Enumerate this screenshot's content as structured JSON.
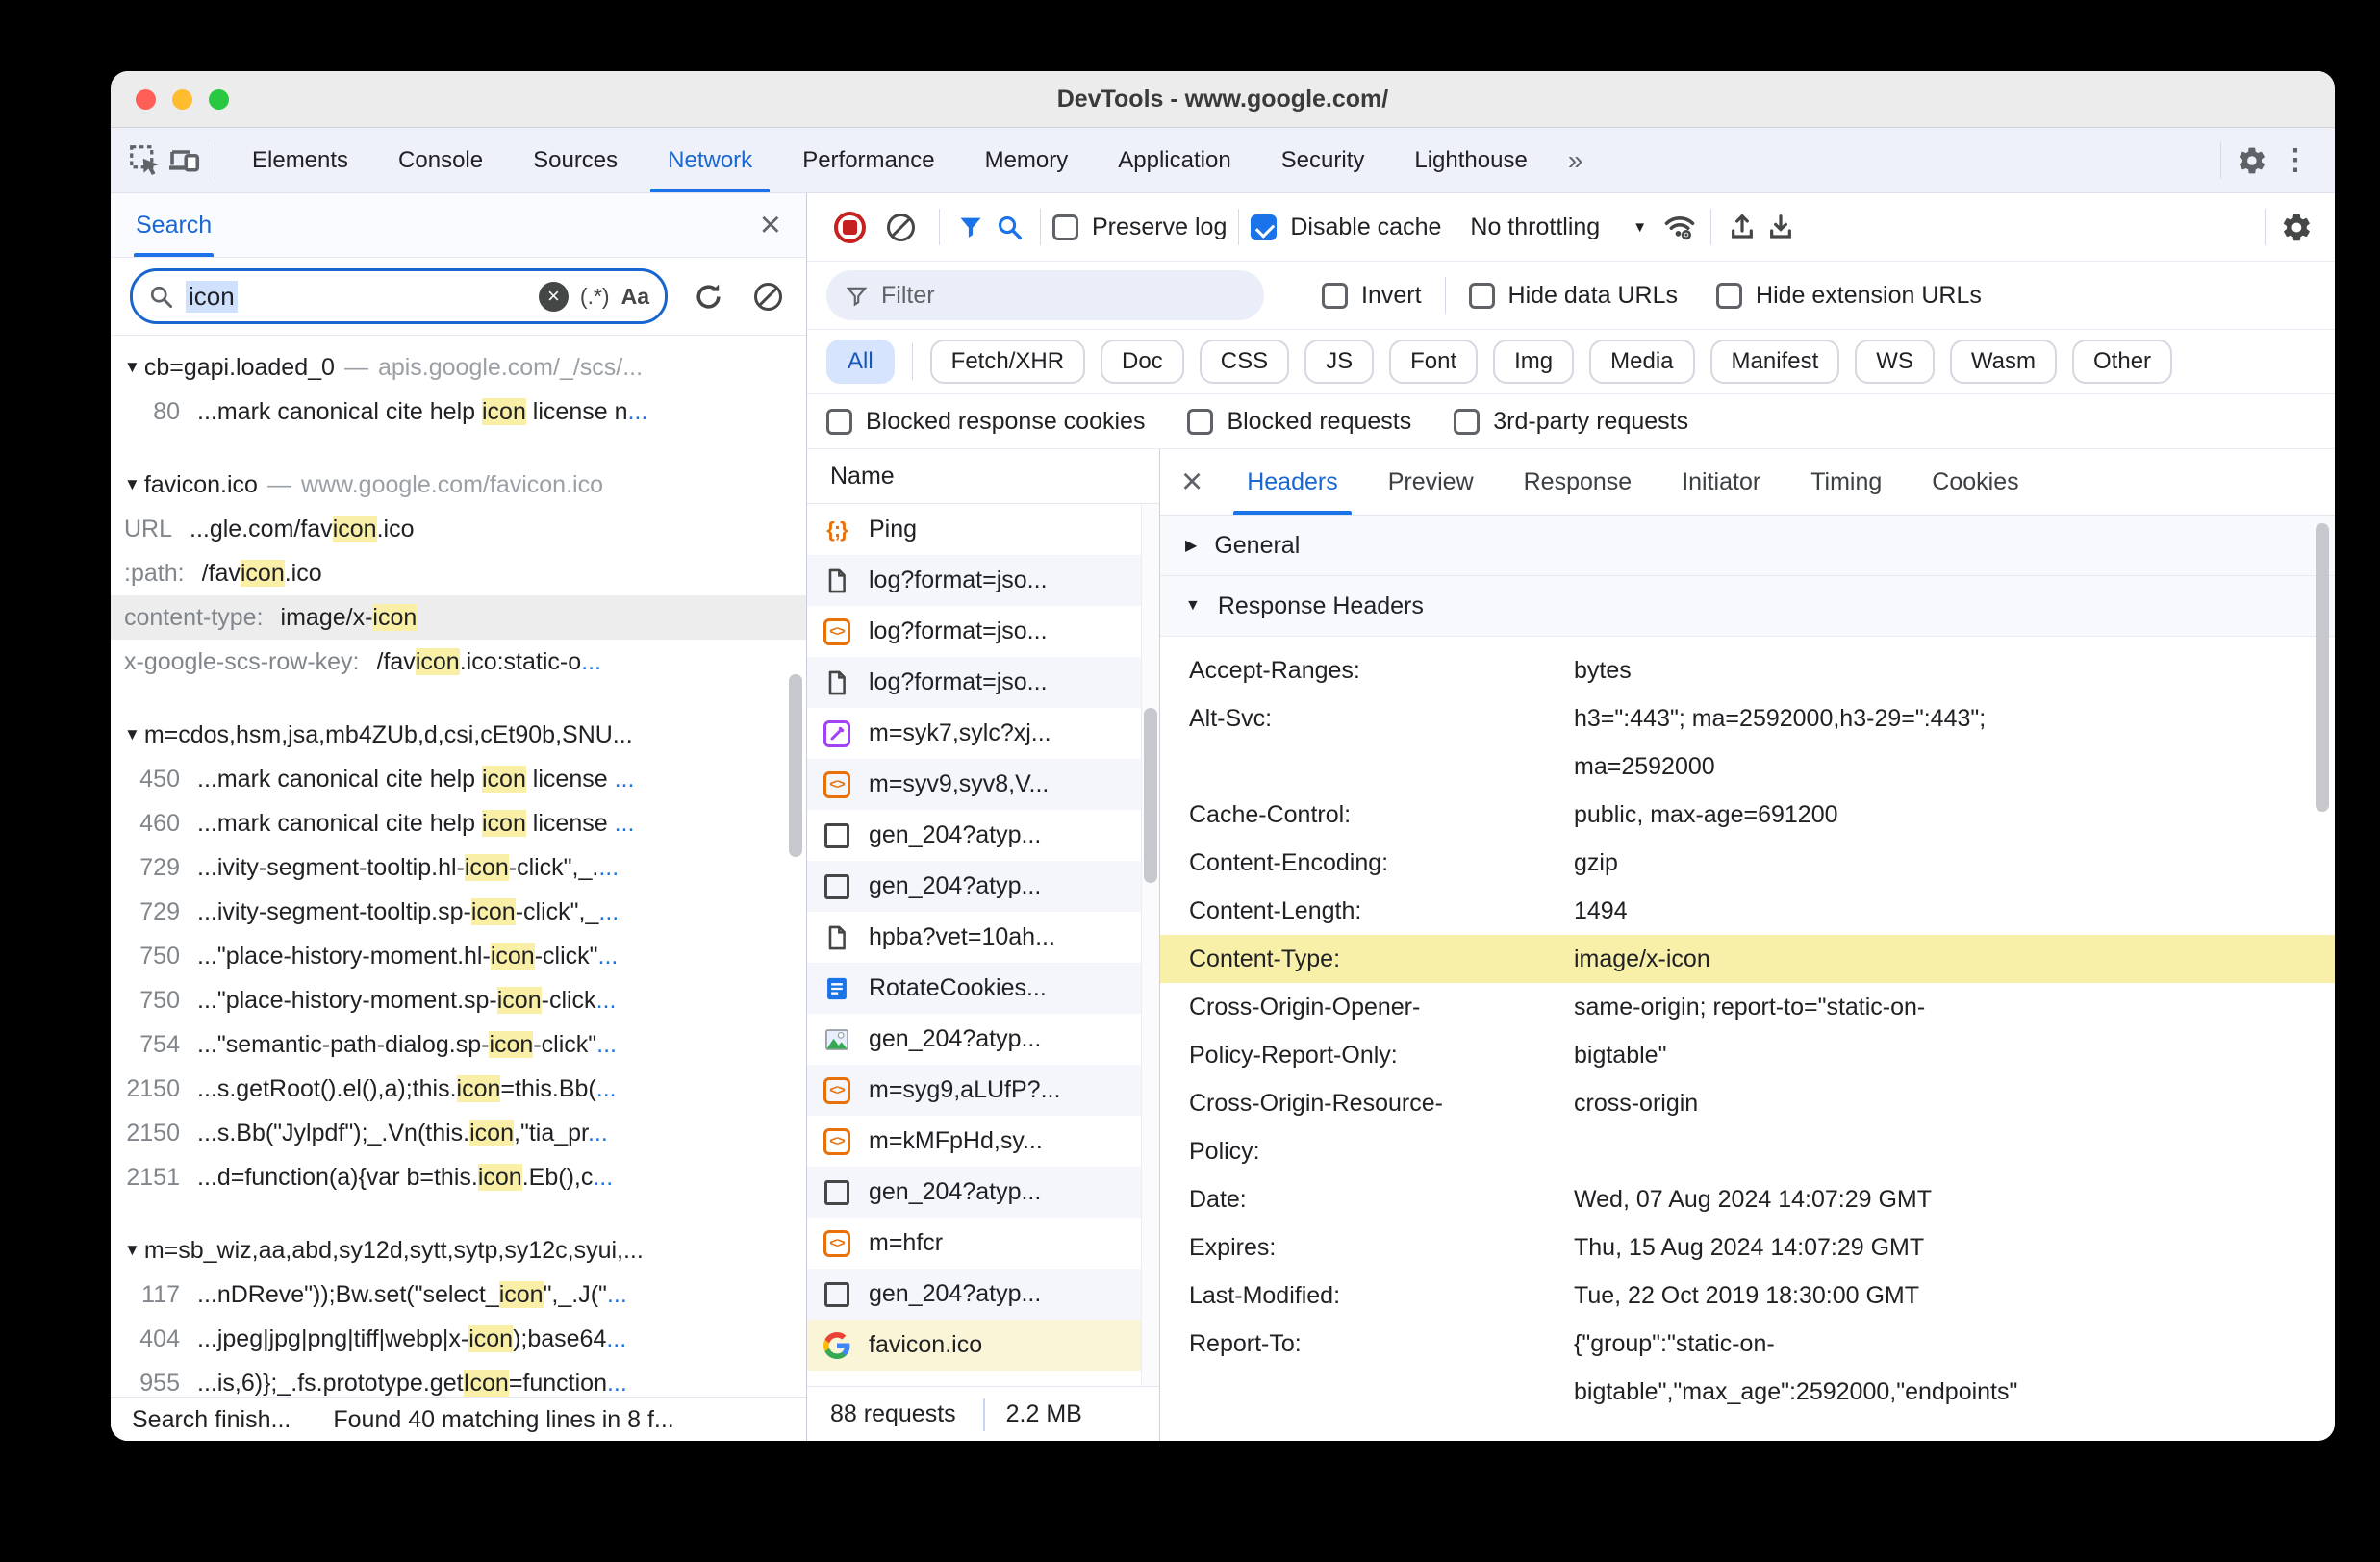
{
  "window": {
    "title": "DevTools - www.google.com/"
  },
  "chrome": {
    "tabs": [
      {
        "label": "Elements",
        "active": false
      },
      {
        "label": "Console",
        "active": false
      },
      {
        "label": "Sources",
        "active": false
      },
      {
        "label": "Network",
        "active": true
      },
      {
        "label": "Performance",
        "active": false
      },
      {
        "label": "Memory",
        "active": false
      },
      {
        "label": "Application",
        "active": false
      },
      {
        "label": "Security",
        "active": false
      },
      {
        "label": "Lighthouse",
        "active": false
      }
    ],
    "more_tabs": "»"
  },
  "search": {
    "tab": "Search",
    "query": "icon",
    "regex_label": "(.*)",
    "case_label": "Aa",
    "status_left": "Search finish...",
    "status_right": "Found 40 matching lines in 8 f...",
    "results": [
      {
        "type": "file",
        "name": "cb=gapi.loaded_0",
        "url": "apis.google.com/_/scs/..."
      },
      {
        "type": "match",
        "label": "80",
        "num": true,
        "segs": [
          {
            "t": "...mark canonical cite help "
          },
          {
            "t": "icon",
            "h": true
          },
          {
            "t": " license n"
          },
          {
            "t": "...",
            "b": true
          }
        ]
      },
      {
        "type": "gap"
      },
      {
        "type": "file",
        "name": "favicon.ico",
        "url": "www.google.com/favicon.ico"
      },
      {
        "type": "match",
        "label": "URL",
        "segs": [
          {
            "t": "...gle.com/fav"
          },
          {
            "t": "icon",
            "h": true
          },
          {
            "t": ".ico"
          }
        ]
      },
      {
        "type": "match",
        "label": ":path:",
        "segs": [
          {
            "t": "/fav"
          },
          {
            "t": "icon",
            "h": true
          },
          {
            "t": ".ico"
          }
        ]
      },
      {
        "type": "match",
        "label": "content-type:",
        "sel": true,
        "segs": [
          {
            "t": "image/x-"
          },
          {
            "t": "icon",
            "h": true
          }
        ]
      },
      {
        "type": "match",
        "label": "x-google-scs-row-key:",
        "segs": [
          {
            "t": "/fav"
          },
          {
            "t": "icon",
            "h": true
          },
          {
            "t": ".ico:static-o"
          },
          {
            "t": "...",
            "b": true
          }
        ]
      },
      {
        "type": "gap"
      },
      {
        "type": "file",
        "name": "m=cdos,hsm,jsa,mb4ZUb,d,csi,cEt90b,SNU...",
        "url": ""
      },
      {
        "type": "match",
        "label": "450",
        "num": true,
        "segs": [
          {
            "t": "...mark canonical cite help "
          },
          {
            "t": "icon",
            "h": true
          },
          {
            "t": " license "
          },
          {
            "t": "...",
            "b": true
          }
        ]
      },
      {
        "type": "match",
        "label": "460",
        "num": true,
        "segs": [
          {
            "t": "...mark canonical cite help "
          },
          {
            "t": "icon",
            "h": true
          },
          {
            "t": " license "
          },
          {
            "t": "...",
            "b": true
          }
        ]
      },
      {
        "type": "match",
        "label": "729",
        "num": true,
        "segs": [
          {
            "t": "...ivity-segment-tooltip.hl-"
          },
          {
            "t": "icon",
            "h": true
          },
          {
            "t": "-click\",_."
          },
          {
            "t": "...",
            "b": true
          }
        ]
      },
      {
        "type": "match",
        "label": "729",
        "num": true,
        "segs": [
          {
            "t": "...ivity-segment-tooltip.sp-"
          },
          {
            "t": "icon",
            "h": true
          },
          {
            "t": "-click\",_"
          },
          {
            "t": "...",
            "b": true
          }
        ]
      },
      {
        "type": "match",
        "label": "750",
        "num": true,
        "segs": [
          {
            "t": "...\"place-history-moment.hl-"
          },
          {
            "t": "icon",
            "h": true
          },
          {
            "t": "-click\""
          },
          {
            "t": "...",
            "b": true
          }
        ]
      },
      {
        "type": "match",
        "label": "750",
        "num": true,
        "segs": [
          {
            "t": "...\"place-history-moment.sp-"
          },
          {
            "t": "icon",
            "h": true
          },
          {
            "t": "-click"
          },
          {
            "t": "...",
            "b": true
          }
        ]
      },
      {
        "type": "match",
        "label": "754",
        "num": true,
        "segs": [
          {
            "t": "...\"semantic-path-dialog.sp-"
          },
          {
            "t": "icon",
            "h": true
          },
          {
            "t": "-click\""
          },
          {
            "t": "...",
            "b": true
          }
        ]
      },
      {
        "type": "match",
        "label": "2150",
        "num": true,
        "segs": [
          {
            "t": "...s.getRoot().el(),a);this."
          },
          {
            "t": "icon",
            "h": true
          },
          {
            "t": "=this.Bb("
          },
          {
            "t": "...",
            "b": true
          }
        ]
      },
      {
        "type": "match",
        "label": "2150",
        "num": true,
        "segs": [
          {
            "t": "...s.Bb(\"Jylpdf\");_.Vn(this."
          },
          {
            "t": "icon",
            "h": true
          },
          {
            "t": ",\"tia_pr"
          },
          {
            "t": "...",
            "b": true
          }
        ]
      },
      {
        "type": "match",
        "label": "2151",
        "num": true,
        "segs": [
          {
            "t": "...d=function(a){var b=this."
          },
          {
            "t": "icon",
            "h": true
          },
          {
            "t": ".Eb(),c"
          },
          {
            "t": "...",
            "b": true
          }
        ]
      },
      {
        "type": "gap"
      },
      {
        "type": "file",
        "name": "m=sb_wiz,aa,abd,sy12d,sytt,sytp,sy12c,syui,...",
        "url": ""
      },
      {
        "type": "match",
        "label": "117",
        "num": true,
        "segs": [
          {
            "t": "...nDReve\"));Bw.set(\"select_"
          },
          {
            "t": "icon",
            "h": true
          },
          {
            "t": "\",_.J(\""
          },
          {
            "t": "...",
            "b": true
          }
        ]
      },
      {
        "type": "match",
        "label": "404",
        "num": true,
        "segs": [
          {
            "t": "...jpeg|jpg|png|tiff|webp|x-"
          },
          {
            "t": "icon",
            "h": true
          },
          {
            "t": ");base64"
          },
          {
            "t": "...",
            "b": true
          }
        ]
      },
      {
        "type": "match",
        "label": "955",
        "num": true,
        "segs": [
          {
            "t": "...is,6)};_.fs.prototype.get"
          },
          {
            "t": "Icon",
            "h": true
          },
          {
            "t": "=function"
          },
          {
            "t": "...",
            "b": true
          }
        ]
      }
    ]
  },
  "network": {
    "toolbar": {
      "preserve_log": "Preserve log",
      "disable_cache": "Disable cache",
      "throttling": "No throttling"
    },
    "filter_placeholder": "Filter",
    "invert": "Invert",
    "hide_data": "Hide data URLs",
    "hide_ext": "Hide extension URLs",
    "chips": [
      {
        "label": "All",
        "active": true
      },
      {
        "label": "Fetch/XHR",
        "active": false
      },
      {
        "label": "Doc",
        "active": false
      },
      {
        "label": "CSS",
        "active": false
      },
      {
        "label": "JS",
        "active": false
      },
      {
        "label": "Font",
        "active": false
      },
      {
        "label": "Img",
        "active": false
      },
      {
        "label": "Media",
        "active": false
      },
      {
        "label": "Manifest",
        "active": false
      },
      {
        "label": "WS",
        "active": false
      },
      {
        "label": "Wasm",
        "active": false
      },
      {
        "label": "Other",
        "active": false
      }
    ],
    "blocked": [
      "Blocked response cookies",
      "Blocked requests",
      "3rd-party requests"
    ],
    "name_header": "Name",
    "requests": [
      {
        "icon": "json-ping",
        "name": "Ping"
      },
      {
        "icon": "document",
        "name": "log?format=jso..."
      },
      {
        "icon": "xhr",
        "name": "log?format=jso..."
      },
      {
        "icon": "document",
        "name": "log?format=jso..."
      },
      {
        "icon": "stylesheet",
        "name": "m=syk7,sylc?xj..."
      },
      {
        "icon": "xhr",
        "name": "m=syv9,syv8,V..."
      },
      {
        "icon": "plain",
        "name": "gen_204?atyp..."
      },
      {
        "icon": "plain",
        "name": "gen_204?atyp..."
      },
      {
        "icon": "document",
        "name": "hpba?vet=10ah..."
      },
      {
        "icon": "doc-blue",
        "name": "RotateCookies..."
      },
      {
        "icon": "image",
        "name": "gen_204?atyp..."
      },
      {
        "icon": "xhr",
        "name": "m=syg9,aLUfP?..."
      },
      {
        "icon": "xhr",
        "name": "m=kMFpHd,sy..."
      },
      {
        "icon": "plain",
        "name": "gen_204?atyp..."
      },
      {
        "icon": "xhr",
        "name": "m=hfcr"
      },
      {
        "icon": "plain",
        "name": "gen_204?atyp..."
      },
      {
        "icon": "google-g",
        "name": "favicon.ico",
        "selected": true
      }
    ],
    "status": {
      "requests": "88 requests",
      "size": "2.2 MB"
    }
  },
  "details": {
    "tabs": [
      {
        "label": "Headers",
        "active": true
      },
      {
        "label": "Preview",
        "active": false
      },
      {
        "label": "Response",
        "active": false
      },
      {
        "label": "Initiator",
        "active": false
      },
      {
        "label": "Timing",
        "active": false
      },
      {
        "label": "Cookies",
        "active": false
      }
    ],
    "sections": {
      "general": "General",
      "response_headers": "Response Headers"
    },
    "headers": [
      {
        "key": [
          "Accept-Ranges:"
        ],
        "val": [
          "bytes"
        ]
      },
      {
        "key": [
          "Alt-Svc:"
        ],
        "val": [
          "h3=\":443\"; ma=2592000,h3-29=\":443\";",
          "ma=2592000"
        ]
      },
      {
        "key": [
          "Cache-Control:"
        ],
        "val": [
          "public, max-age=691200"
        ]
      },
      {
        "key": [
          "Content-Encoding:"
        ],
        "val": [
          "gzip"
        ]
      },
      {
        "key": [
          "Content-Length:"
        ],
        "val": [
          "1494"
        ]
      },
      {
        "key": [
          "Content-Type:"
        ],
        "val": [
          "image/x-icon"
        ],
        "hl": true
      },
      {
        "key": [
          "Cross-Origin-Opener-",
          "Policy-Report-Only:"
        ],
        "val": [
          "same-origin; report-to=\"static-on-",
          "bigtable\""
        ]
      },
      {
        "key": [
          "Cross-Origin-Resource-",
          "Policy:"
        ],
        "val": [
          "cross-origin"
        ]
      },
      {
        "key": [
          "Date:"
        ],
        "val": [
          "Wed, 07 Aug 2024 14:07:29 GMT"
        ]
      },
      {
        "key": [
          "Expires:"
        ],
        "val": [
          "Thu, 15 Aug 2024 14:07:29 GMT"
        ]
      },
      {
        "key": [
          "Last-Modified:"
        ],
        "val": [
          "Tue, 22 Oct 2019 18:30:00 GMT"
        ]
      },
      {
        "key": [
          "Report-To:"
        ],
        "val": [
          "{\"group\":\"static-on-",
          "bigtable\",\"max_age\":2592000,\"endpoints\""
        ]
      }
    ]
  }
}
